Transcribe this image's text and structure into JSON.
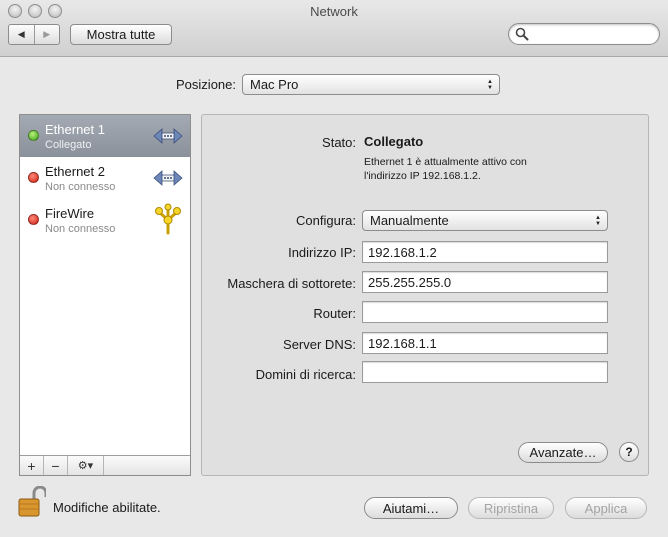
{
  "window": {
    "title": "Network"
  },
  "toolbar": {
    "back_label": "◀",
    "forward_label": "▶",
    "show_all_label": "Mostra tutte",
    "search_placeholder": ""
  },
  "location": {
    "label": "Posizione:",
    "value": "Mac Pro"
  },
  "services": [
    {
      "name": "Ethernet 1",
      "status": "Collegato",
      "state": "green",
      "icon": "ethernet-icon"
    },
    {
      "name": "Ethernet 2",
      "status": "Non connesso",
      "state": "red",
      "icon": "ethernet-icon"
    },
    {
      "name": "FireWire",
      "status": "Non connesso",
      "state": "red",
      "icon": "firewire-icon"
    }
  ],
  "sidebar_footer": {
    "add": "+",
    "remove": "−",
    "action": "⚙▾"
  },
  "detail": {
    "status_label": "Stato:",
    "status_value": "Collegato",
    "status_desc_line1": "Ethernet 1 è attualmente attivo con",
    "status_desc_line2": "l'indirizzo IP 192.168.1.2.",
    "configure_label": "Configura:",
    "configure_value": "Manualmente",
    "ip_label": "Indirizzo IP:",
    "ip_value": "192.168.1.2",
    "subnet_label": "Maschera di sottorete:",
    "subnet_value": "255.255.255.0",
    "router_label": "Router:",
    "router_value": "",
    "dns_label": "Server DNS:",
    "dns_value": "192.168.1.1",
    "search_domains_label": "Domini di ricerca:",
    "search_domains_value": "",
    "advanced_label": "Avanzate…",
    "help_label": "?"
  },
  "bottom": {
    "lock_text": "Modifiche abilitate.",
    "assist_label": "Aiutami…",
    "revert_label": "Ripristina",
    "apply_label": "Applica"
  },
  "colors": {
    "status_green": "#3aa316",
    "status_red": "#cf1d10",
    "selection": "#8a919b"
  }
}
